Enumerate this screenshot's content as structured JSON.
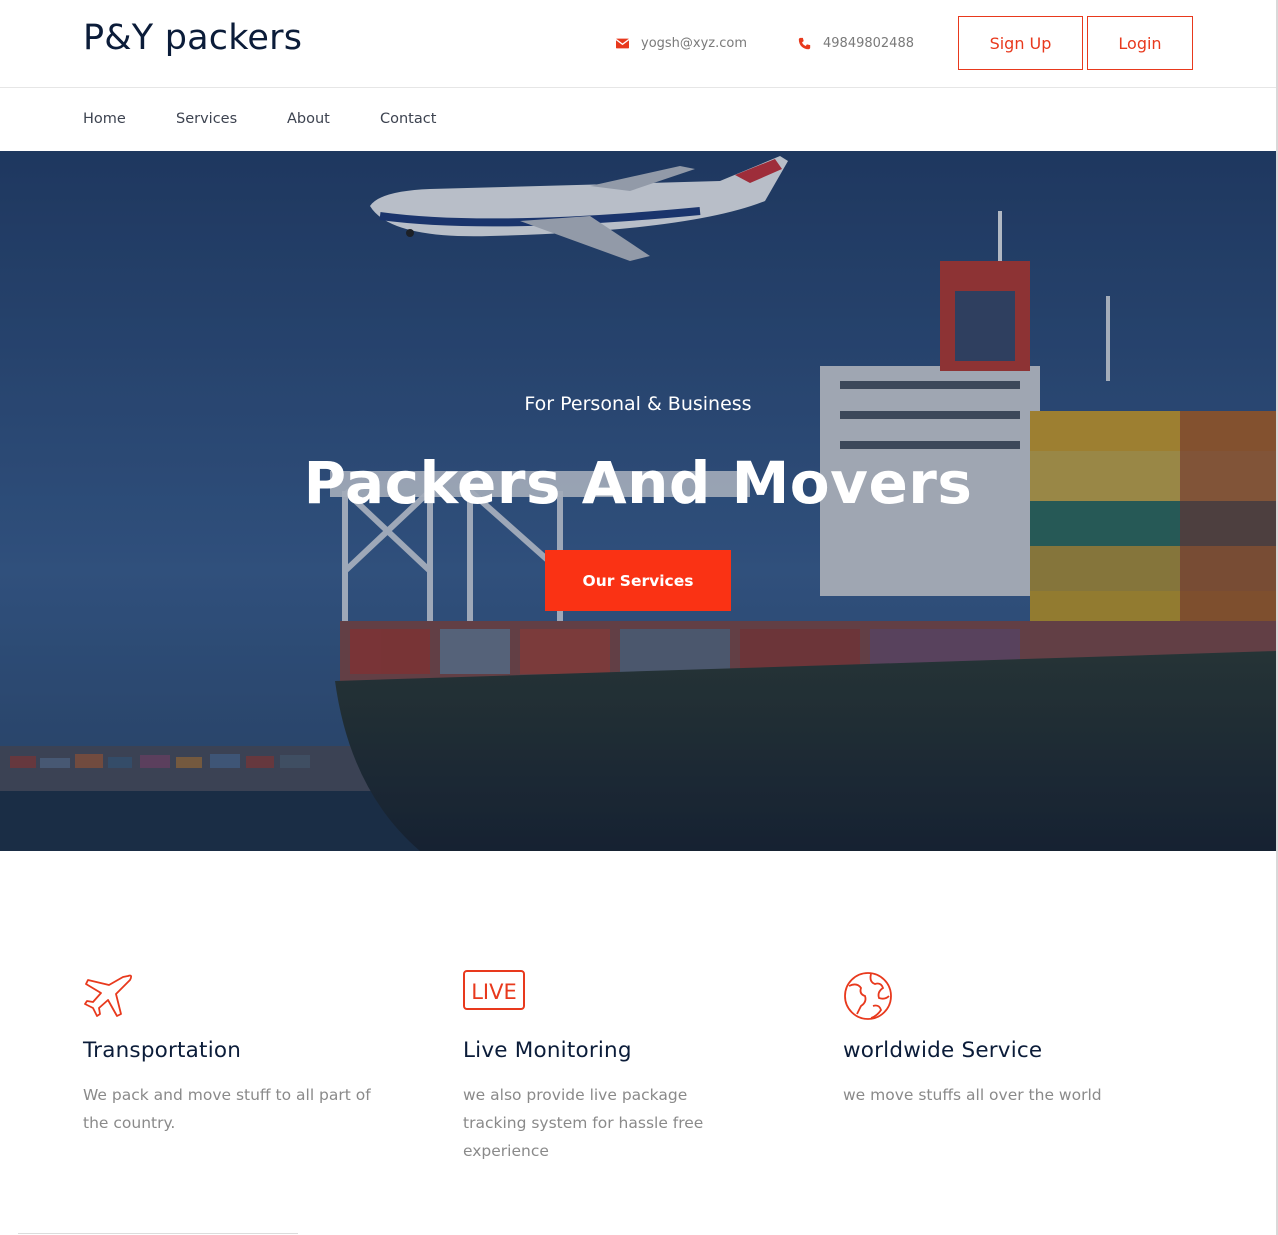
{
  "header": {
    "logo": "P&Y packers",
    "email": "yogsh@xyz.com",
    "phone": "49849802488",
    "signup_label": "Sign Up",
    "login_label": "Login",
    "accent_color": "#e8391d"
  },
  "nav": {
    "items": [
      {
        "label": "Home"
      },
      {
        "label": "Services"
      },
      {
        "label": "About"
      },
      {
        "label": "Contact"
      }
    ]
  },
  "hero": {
    "subtitle": "For Personal & Business",
    "title": "Packers And Movers",
    "cta_label": "Our Services",
    "cta_color": "#fa3214"
  },
  "features": [
    {
      "icon": "airplane-icon",
      "title": "Transportation",
      "text": "We pack and move stuff to all part of the country."
    },
    {
      "icon": "live-icon",
      "title": "Live Monitoring",
      "text": "we also provide live package tracking system for hassle free experience",
      "icon_text": "LIVE"
    },
    {
      "icon": "globe-icon",
      "title": "worldwide Service",
      "text": "we move stuffs all over the world"
    }
  ]
}
